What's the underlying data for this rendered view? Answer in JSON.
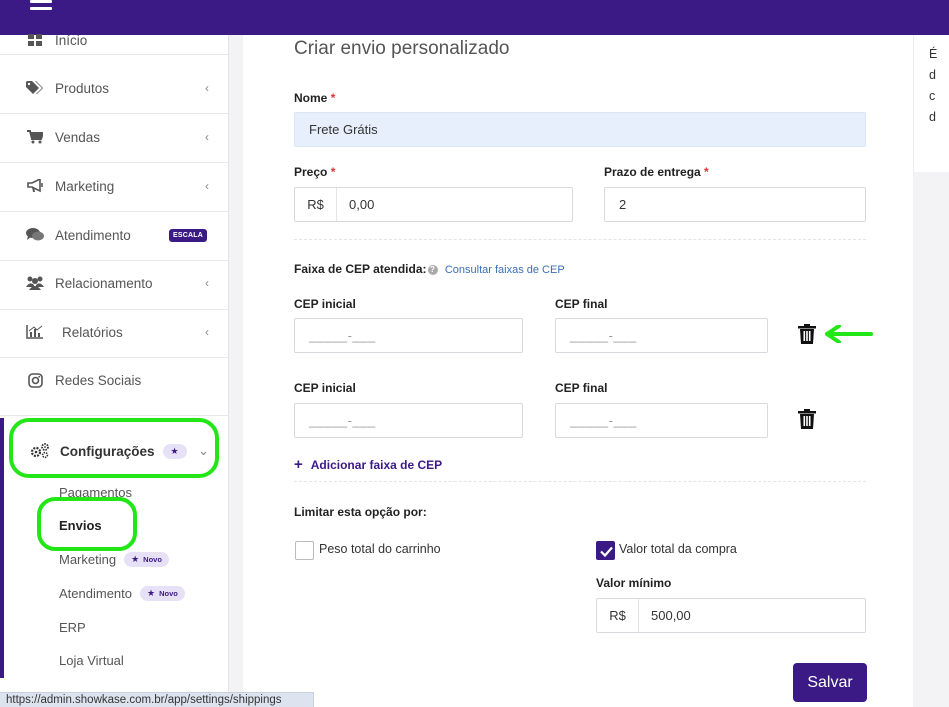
{
  "sidebar": {
    "items": [
      {
        "label": "Início",
        "icon": "grid-icon"
      },
      {
        "label": "Produtos",
        "icon": "tags-icon",
        "chevron": "‹"
      },
      {
        "label": "Vendas",
        "icon": "cart-icon",
        "chevron": "‹"
      },
      {
        "label": "Marketing",
        "icon": "megaphone-icon",
        "chevron": "‹"
      },
      {
        "label": "Atendimento",
        "icon": "chat-icon",
        "badge": "ESCALA"
      },
      {
        "label": "Relacionamento",
        "icon": "users-icon",
        "chevron": "‹"
      },
      {
        "label": "Relatórios",
        "icon": "chart-icon",
        "chevron": "‹"
      },
      {
        "label": "Redes Sociais",
        "icon": "instagram-icon"
      }
    ],
    "config": {
      "label": "Configurações",
      "star": "★",
      "chevron": "⌄"
    },
    "sub_items": [
      {
        "label": "Pagamentos"
      },
      {
        "label": "Envios"
      },
      {
        "label": "Marketing",
        "pill": "Novo"
      },
      {
        "label": "Atendimento",
        "pill": "Novo"
      },
      {
        "label": "ERP"
      },
      {
        "label": "Loja Virtual"
      }
    ]
  },
  "form": {
    "title": "Criar envio personalizado",
    "nome_label": "Nome",
    "nome_value": "Frete Grátis",
    "preco_label": "Preço",
    "preco_prefix": "R$",
    "preco_value": "0,00",
    "prazo_label": "Prazo de entrega",
    "prazo_value": "2",
    "required_mark": "*",
    "cep_section_label": "Faixa de CEP atendida:",
    "cep_help": "?",
    "cep_link": "Consultar faixas de CEP",
    "cep_ranges": [
      {
        "inicial_label": "CEP inicial",
        "final_label": "CEP final",
        "inicial_placeholder": "_____-___",
        "final_placeholder": "_____-___"
      },
      {
        "inicial_label": "CEP inicial",
        "final_label": "CEP final",
        "inicial_placeholder": "_____-___",
        "final_placeholder": "_____-___"
      }
    ],
    "add_cep_label": "Adicionar faixa de CEP",
    "add_cep_plus": "+",
    "limit_label": "Limitar esta opção por:",
    "peso_label": "Peso total do carrinho",
    "peso_checked": false,
    "valor_total_label": "Valor total da compra",
    "valor_total_checked": true,
    "valor_minimo_label": "Valor mínimo",
    "valor_minimo_prefix": "R$",
    "valor_minimo_value": "500,00",
    "save_label": "Salvar"
  },
  "right_panel": {
    "lines": [
      "É",
      "d",
      "c",
      "d"
    ]
  },
  "status_url": "https://admin.showkase.com.br/app/settings/shippings",
  "colors": {
    "brand": "#3b1a86",
    "highlight": "#22e616",
    "input_filled": "#e6effb"
  }
}
